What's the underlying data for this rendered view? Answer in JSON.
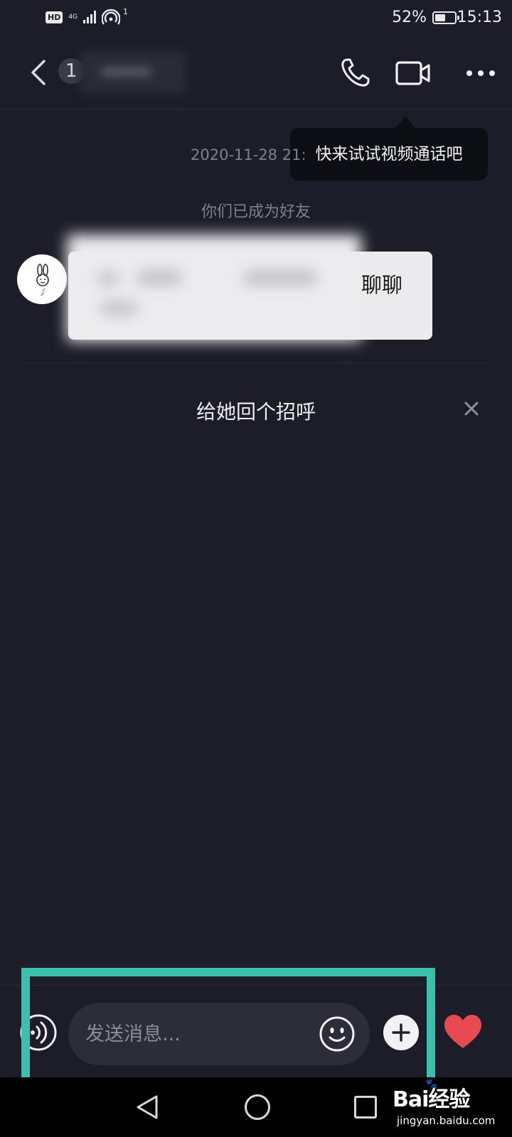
{
  "status_bar": {
    "hd_label": "HD",
    "network_label": "4G",
    "hotspot_count": "1",
    "battery_percent": "52%",
    "battery_level": 0.52,
    "time": "15:13"
  },
  "header": {
    "contact_initial": "1",
    "icons": [
      "chevron-left-icon",
      "phone-icon",
      "video-camera-icon",
      "more-icon"
    ]
  },
  "tooltip": {
    "text": "快来试试视频通话吧"
  },
  "chat": {
    "timestamp": "2020-11-28 21:",
    "system_message": "你们已成为好友",
    "messages": [
      {
        "sender": "contact",
        "text_visible": "聊聊"
      }
    ]
  },
  "greet_prompt": {
    "text": "给她回个招呼"
  },
  "composer": {
    "placeholder": "发送消息...",
    "icons": [
      "voice-icon",
      "emoji-icon",
      "plus-icon",
      "heart-icon"
    ]
  },
  "colors": {
    "background": "#1c1d28",
    "highlight": "#3dbfae",
    "heart": "#e84a54",
    "bubble": "#ebebed"
  },
  "watermark": {
    "logo": "Bai经验",
    "url": "jingyan.baidu.com"
  }
}
